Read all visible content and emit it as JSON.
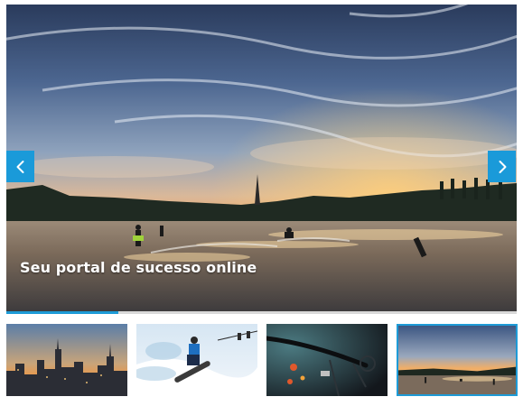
{
  "slider": {
    "caption": "Seu portal de sucesso online",
    "prev_icon": "chevron-left-icon",
    "next_icon": "chevron-right-icon",
    "progress": 0.22,
    "active_slide": 4
  },
  "thumbnails": [
    {
      "name": "thumbnail-city-skyline",
      "subject": "city-skyline-sunset"
    },
    {
      "name": "thumbnail-snowboarder",
      "subject": "snowboarder-jump"
    },
    {
      "name": "thumbnail-bicycle",
      "subject": "bicycle-handlebar-dusk"
    },
    {
      "name": "thumbnail-lake-sunset",
      "subject": "wakeboard-lake-sunset",
      "active": true
    }
  ],
  "colors": {
    "accent": "#1e9bd7",
    "arrow_bg": "#1a9ad9"
  }
}
